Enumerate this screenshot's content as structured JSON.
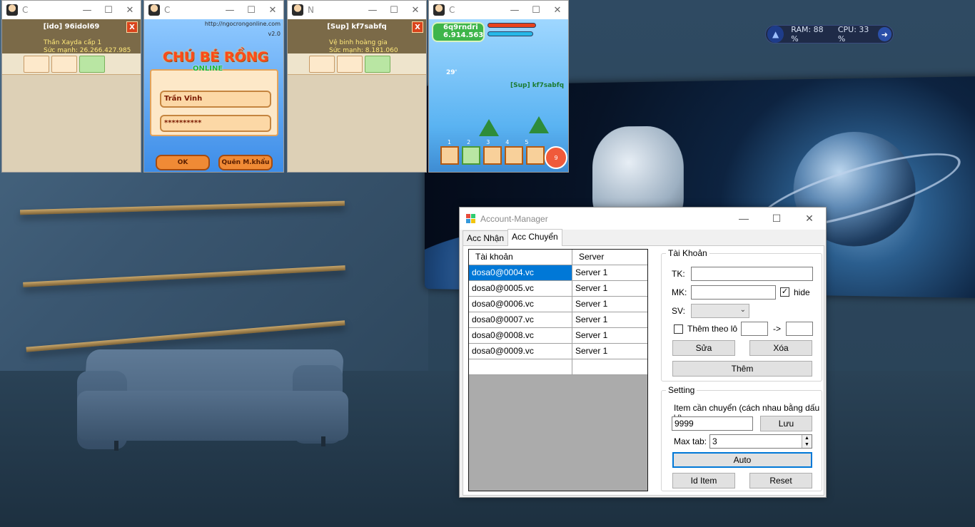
{
  "desktop": {
    "widget": {
      "ram_label": "RAM: 88 %",
      "cpu_label": "CPU: 33 %"
    }
  },
  "game_windows": [
    {
      "title": "C",
      "player_name": "[ido] 96idol69",
      "line1": "Thần Xayda cấp 1",
      "line2": "Sức mạnh: 26.266.427.985",
      "close": "X"
    },
    {
      "title": "C",
      "url": "http://ngocrongonline.com",
      "version": "v2.0",
      "logo": "CHÚ BÉ RỒNG",
      "logo_sub": "ONLINE",
      "username": "Trần Vinh",
      "password": "**********",
      "ok": "OK",
      "forgot": "Quên M.khẩu"
    },
    {
      "title": "N",
      "player_name": "[Sup] kf7sabfq",
      "line1": "Vệ binh hoàng gia",
      "line2": "Sức mạnh: 8.181.060",
      "close": "X"
    },
    {
      "title": "C",
      "player_name": "6q9rndri",
      "power": "6.914.563",
      "timer": "29'",
      "tag": "[Sup] kf7sabfq",
      "hotkeys": [
        "1",
        "2",
        "3",
        "4",
        "5"
      ],
      "heart_count": "9"
    }
  ],
  "account_manager": {
    "title": "Account-Manager",
    "tabs": [
      {
        "label": "Acc Nhận",
        "active": false
      },
      {
        "label": "Acc Chuyển",
        "active": true
      }
    ],
    "grid": {
      "headers": [
        "Tài khoản",
        "Server"
      ],
      "rows": [
        [
          "dosa0@0004.vc",
          "Server 1"
        ],
        [
          "dosa0@0005.vc",
          "Server 1"
        ],
        [
          "dosa0@0006.vc",
          "Server 1"
        ],
        [
          "dosa0@0007.vc",
          "Server 1"
        ],
        [
          "dosa0@0008.vc",
          "Server 1"
        ],
        [
          "dosa0@0009.vc",
          "Server 1"
        ]
      ],
      "selected_row": 0
    },
    "account_group": {
      "legend": "Tài Khoản",
      "tk_label": "TK:",
      "tk_value": "",
      "mk_label": "MK:",
      "mk_value": "",
      "hide_label": "hide",
      "hide_checked": true,
      "sv_label": "SV:",
      "sv_value": "",
      "batch_label": "Thêm theo lô",
      "batch_checked": false,
      "batch_from": "",
      "batch_arrow": "->",
      "batch_to": "",
      "edit_label": "Sửa",
      "delete_label": "Xóa",
      "add_label": "Thêm"
    },
    "setting_group": {
      "legend": "Setting",
      "item_label": "Item cần chuyển (cách nhau bằng dấu ',')",
      "item_value": "9999",
      "save_label": "Lưu",
      "max_tab_label": "Max tab:",
      "max_tab_value": "3",
      "auto_label": "Auto",
      "id_item_label": "Id Item",
      "reset_label": "Reset"
    }
  }
}
